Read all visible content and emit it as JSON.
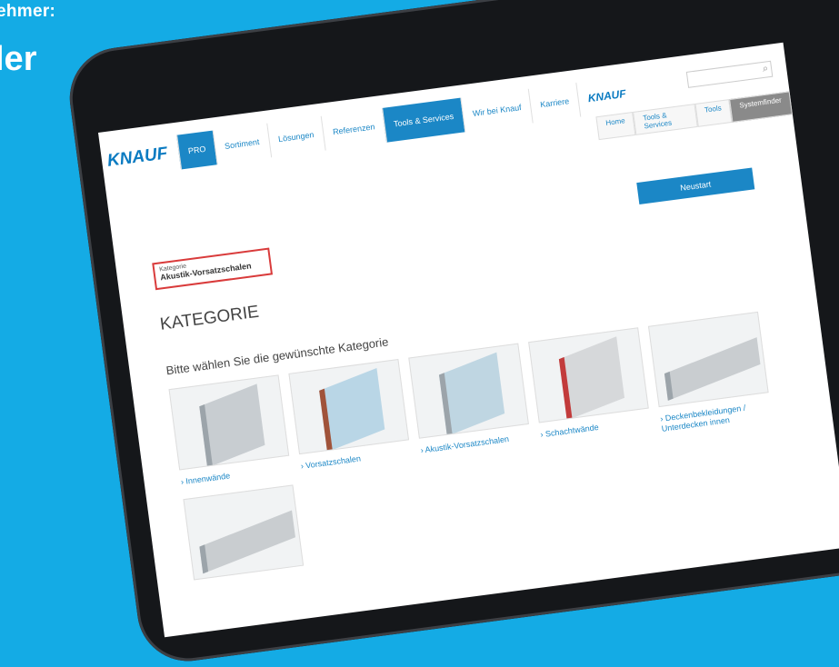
{
  "overlay": {
    "line1": "ehmer:",
    "line2": "ler"
  },
  "website": {
    "logo": "KNAUF",
    "nav": [
      "PRO",
      "Sortiment",
      "Lösungen",
      "Referenzen",
      "Tools & Services",
      "Wir bei Knauf",
      "Karriere"
    ],
    "mini_logo": "KNAUF",
    "breadcrumbs": [
      "Home",
      "Tools & Services",
      "Tools",
      "Systemfinder"
    ],
    "filter": {
      "label": "Kategorie",
      "value": "Akustik-Vorsatzschalen"
    },
    "restart_button": "Neustart",
    "section_title": "KATEGORIE",
    "section_subtitle": "Bitte wählen Sie die gewünschte Kategorie",
    "categories": [
      "› Innenwände",
      "› Vorsatzschalen",
      "› Akustik-Vorsatzschalen",
      "› Schachtwände",
      "› Deckenbekleidungen / Unterdecken innen"
    ]
  }
}
